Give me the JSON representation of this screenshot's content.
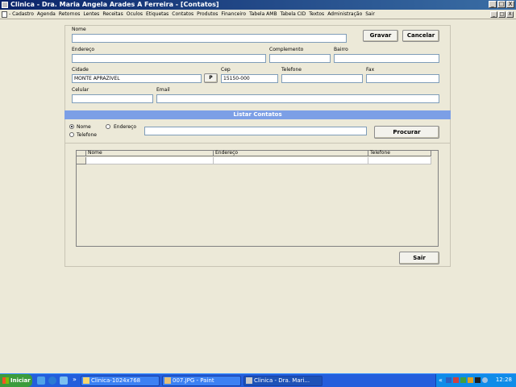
{
  "window": {
    "title": "Clinica - Dra. Maria Angela Arades A Ferreira - [Contatos]",
    "min_label": "_",
    "max_label": "□",
    "close_label": "X"
  },
  "menu": {
    "items": [
      "- Cadastro",
      "Agenda",
      "Retornos",
      "Lentes",
      "Receitas",
      "Oculos",
      "Etiquetas",
      "Contatos",
      "Produtos",
      "Financeiro",
      "Tabela AMB",
      "Tabela CID",
      "Textos",
      "Administração",
      "Sair"
    ]
  },
  "form": {
    "nome_label": "Nome",
    "nome_value": "",
    "endereco_label": "Endereço",
    "endereco_value": "",
    "complemento_label": "Complemento",
    "complemento_value": "",
    "bairro_label": "Bairro",
    "bairro_value": "",
    "cidade_label": "Cidade",
    "cidade_value": "MONTE APRAZIVEL",
    "p_button": "P",
    "cep_label": "Cep",
    "cep_value": "15150-000",
    "telefone_label": "Telefone",
    "telefone_value": "",
    "fax_label": "Fax",
    "fax_value": "",
    "celular_label": "Celular",
    "celular_value": "",
    "email_label": "Email",
    "email_value": "",
    "gravar_button": "Gravar",
    "cancelar_button": "Cancelar"
  },
  "list_section": {
    "title": "Listar Contatos",
    "radio_nome": "Nome",
    "radio_endereco": "Endereço",
    "radio_telefone": "Telefone",
    "selected_radio": "Nome",
    "search_value": "",
    "procurar_button": "Procurar",
    "columns": [
      "Nome",
      "Endereço",
      "Telefone"
    ]
  },
  "sair_button": "Sair",
  "taskbar": {
    "start_label": "Iniciar",
    "tasks": [
      "Clinica-1024x768",
      "007.JPG - Paint",
      "Clinica - Dra. Mari..."
    ],
    "active_task": "Clinica - Dra. Mari...",
    "tray_chevron": "«",
    "clock": "12:28"
  }
}
